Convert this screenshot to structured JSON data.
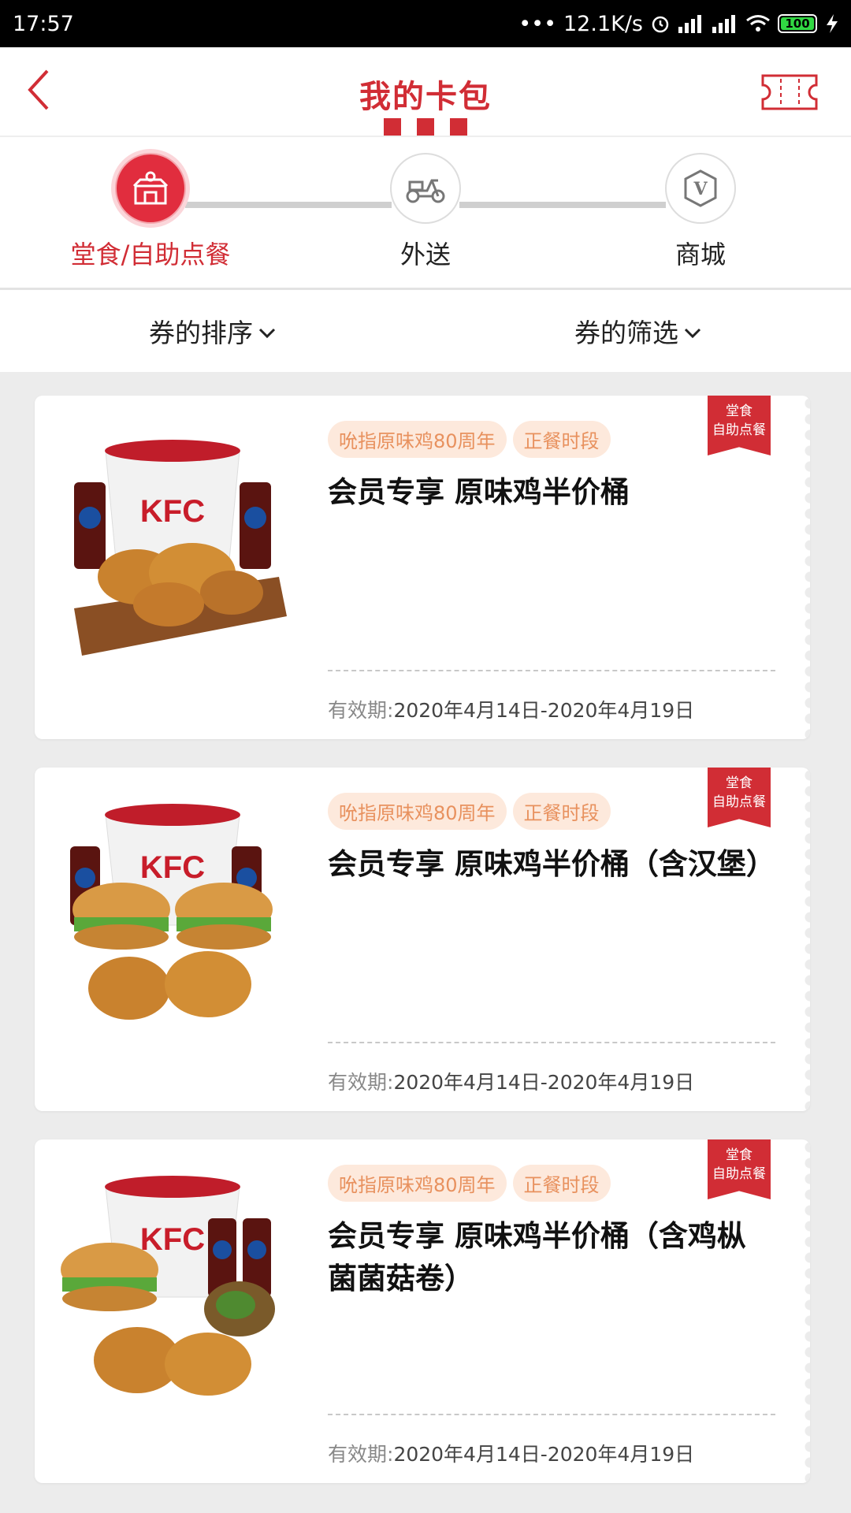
{
  "status_bar": {
    "time": "17:57",
    "net_speed": "12.1K/s",
    "battery": "100"
  },
  "header": {
    "title": "我的卡包"
  },
  "steps": [
    {
      "label": "堂食/自助点餐",
      "active": true,
      "icon": "store-icon"
    },
    {
      "label": "外送",
      "active": false,
      "icon": "scooter-icon"
    },
    {
      "label": "商城",
      "active": false,
      "icon": "v-badge-icon"
    }
  ],
  "filters": {
    "sort_label": "券的排序",
    "filter_label": "券的筛选"
  },
  "coupons": [
    {
      "tags": [
        "吮指原味鸡80周年",
        "正餐时段"
      ],
      "title": "会员专享 原味鸡半价桶",
      "validity_label": "有效期:",
      "validity_value": "2020年4月14日-2020年4月19日",
      "ribbon_line1": "堂食",
      "ribbon_line2": "自助点餐"
    },
    {
      "tags": [
        "吮指原味鸡80周年",
        "正餐时段"
      ],
      "title": "会员专享 原味鸡半价桶（含汉堡）",
      "validity_label": "有效期:",
      "validity_value": "2020年4月14日-2020年4月19日",
      "ribbon_line1": "堂食",
      "ribbon_line2": "自助点餐"
    },
    {
      "tags": [
        "吮指原味鸡80周年",
        "正餐时段"
      ],
      "title": "会员专享 原味鸡半价桶（含鸡枞菌菌菇卷）",
      "validity_label": "有效期:",
      "validity_value": "2020年4月14日-2020年4月19日",
      "ribbon_line1": "堂食",
      "ribbon_line2": "自助点餐"
    }
  ],
  "colors": {
    "brand_red": "#d12d35",
    "tag_bg": "#fde9dc",
    "tag_text": "#e8915e"
  }
}
